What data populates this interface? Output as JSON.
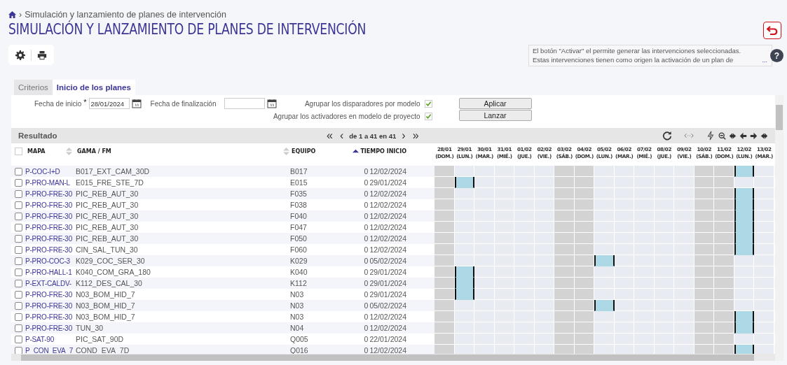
{
  "breadcrumb": {
    "separator": "›",
    "current": "Simulación y lanzamiento de planes de intervención"
  },
  "title": "SIMULACIÓN Y LANZAMIENTO DE PLANES DE INTERVENCIÓN",
  "help": {
    "text": "El botón \"Activar\" el permite generar las intervenciones seleccionadas. Estas intervenciones tienen como origen la activación de un plan de",
    "more": "...",
    "button": "?"
  },
  "tabs": [
    {
      "label": "Criterios",
      "selected": false
    },
    {
      "label": "Inicio de los planes",
      "selected": true
    }
  ],
  "form": {
    "start_label": "Fecha de inicio",
    "required_mark": "*",
    "start_value": "28/01/2024",
    "end_label": "Fecha de finalización",
    "options": [
      {
        "label": "Agrupar los disparadores por modelo",
        "checked": true
      },
      {
        "label": "Agrupar los activadores en modelo de proyecto",
        "checked": true
      }
    ],
    "buttons": [
      "Aplicar",
      "Lanzar"
    ]
  },
  "result": {
    "title": "Resultado",
    "first": "«",
    "prev": "‹",
    "range": "de 1 a 41 en 41",
    "next": "›",
    "last": "»"
  },
  "select_all": {
    "checked": false
  },
  "columns": [
    {
      "label": "MAPA",
      "kind": "plain"
    },
    {
      "label": "GAMA / FM",
      "kind": "sortable"
    },
    {
      "label": "EQUIPO",
      "kind": "sortable"
    },
    {
      "label": "TIEMPO INICIO",
      "kind": "ascending"
    }
  ],
  "days": [
    {
      "date": "28/01",
      "weekday": "(DOM.)",
      "weekend": true
    },
    {
      "date": "29/01",
      "weekday": "(LUN.)",
      "weekend": false
    },
    {
      "date": "30/01",
      "weekday": "(MAR.)",
      "weekend": false
    },
    {
      "date": "31/01",
      "weekday": "(MIÉ.)",
      "weekend": false
    },
    {
      "date": "01/02",
      "weekday": "(JUE.)",
      "weekend": false
    },
    {
      "date": "02/02",
      "weekday": "(VIE.)",
      "weekend": false
    },
    {
      "date": "03/02",
      "weekday": "(SÁB.)",
      "weekend": true
    },
    {
      "date": "04/02",
      "weekday": "(DOM.)",
      "weekend": true
    },
    {
      "date": "05/02",
      "weekday": "(LUN.)",
      "weekend": false
    },
    {
      "date": "06/02",
      "weekday": "(MAR.)",
      "weekend": false
    },
    {
      "date": "07/02",
      "weekday": "(MIÉ.)",
      "weekend": false
    },
    {
      "date": "08/02",
      "weekday": "(JUE.)",
      "weekend": false
    },
    {
      "date": "09/02",
      "weekday": "(VIE.)",
      "weekend": false
    },
    {
      "date": "10/02",
      "weekday": "(SÁB.)",
      "weekend": true
    },
    {
      "date": "11/02",
      "weekday": "(DOM.)",
      "weekend": true
    },
    {
      "date": "12/02",
      "weekday": "(LUN.)",
      "weekend": false
    },
    {
      "date": "13/02",
      "weekday": "(MAR.)",
      "weekend": false
    }
  ],
  "rows": [
    {
      "checked": false,
      "mapa": "P-COC-I+D",
      "gama": "B017_EXT_CAM_30D",
      "equipo": "B017",
      "duration": "0",
      "start": "12/02/2024",
      "planned": [
        false,
        false,
        false,
        false,
        false,
        false,
        false,
        false,
        false,
        false,
        false,
        false,
        false,
        false,
        false,
        true,
        false
      ]
    },
    {
      "checked": false,
      "mapa": "P-PRO-MAN-L",
      "gama": "E015_FRE_STE_7D",
      "equipo": "E015",
      "duration": "0",
      "start": "29/01/2024",
      "planned": [
        false,
        true,
        false,
        false,
        false,
        false,
        false,
        false,
        false,
        false,
        false,
        false,
        false,
        false,
        false,
        false,
        false
      ]
    },
    {
      "checked": false,
      "mapa": "P-PRO-FRE-30",
      "gama": "PIC_REB_AUT_30",
      "equipo": "F035",
      "duration": "0",
      "start": "12/02/2024",
      "planned": [
        false,
        false,
        false,
        false,
        false,
        false,
        false,
        false,
        false,
        false,
        false,
        false,
        false,
        false,
        false,
        true,
        false
      ]
    },
    {
      "checked": false,
      "mapa": "P-PRO-FRE-30",
      "gama": "PIC_REB_AUT_30",
      "equipo": "F038",
      "duration": "0",
      "start": "12/02/2024",
      "planned": [
        false,
        false,
        false,
        false,
        false,
        false,
        false,
        false,
        false,
        false,
        false,
        false,
        false,
        false,
        false,
        true,
        false
      ]
    },
    {
      "checked": false,
      "mapa": "P-PRO-FRE-30",
      "gama": "PIC_REB_AUT_30",
      "equipo": "F040",
      "duration": "0",
      "start": "12/02/2024",
      "planned": [
        false,
        false,
        false,
        false,
        false,
        false,
        false,
        false,
        false,
        false,
        false,
        false,
        false,
        false,
        false,
        true,
        false
      ]
    },
    {
      "checked": false,
      "mapa": "P-PRO-FRE-30",
      "gama": "PIC_REB_AUT_30",
      "equipo": "F047",
      "duration": "0",
      "start": "12/02/2024",
      "planned": [
        false,
        false,
        false,
        false,
        false,
        false,
        false,
        false,
        false,
        false,
        false,
        false,
        false,
        false,
        false,
        true,
        false
      ]
    },
    {
      "checked": false,
      "mapa": "P-PRO-FRE-30",
      "gama": "PIC_REB_AUT_30",
      "equipo": "F050",
      "duration": "0",
      "start": "12/02/2024",
      "planned": [
        false,
        false,
        false,
        false,
        false,
        false,
        false,
        false,
        false,
        false,
        false,
        false,
        false,
        false,
        false,
        true,
        false
      ]
    },
    {
      "checked": false,
      "mapa": "P-PRO-FRE-30",
      "gama": "CIN_SAL_TUN_30",
      "equipo": "F060",
      "duration": "0",
      "start": "12/02/2024",
      "planned": [
        false,
        false,
        false,
        false,
        false,
        false,
        false,
        false,
        false,
        false,
        false,
        false,
        false,
        false,
        false,
        true,
        false
      ]
    },
    {
      "checked": false,
      "mapa": "P-PRO-COC-3",
      "gama": "K029_COC_SER_30",
      "equipo": "K029",
      "duration": "0",
      "start": "05/02/2024",
      "planned": [
        false,
        false,
        false,
        false,
        false,
        false,
        false,
        false,
        true,
        false,
        false,
        false,
        false,
        false,
        false,
        false,
        false
      ]
    },
    {
      "checked": false,
      "mapa": "P-PRO-HALL-1",
      "gama": "K040_COM_GRA_180",
      "equipo": "K040",
      "duration": "0",
      "start": "29/01/2024",
      "planned": [
        false,
        true,
        false,
        false,
        false,
        false,
        false,
        false,
        false,
        false,
        false,
        false,
        false,
        false,
        false,
        false,
        false
      ]
    },
    {
      "checked": false,
      "mapa": "P-EXT-CALDV-",
      "gama": "K112_DES_CAL_30",
      "equipo": "K112",
      "duration": "0",
      "start": "29/01/2024",
      "planned": [
        false,
        true,
        false,
        false,
        false,
        false,
        false,
        false,
        false,
        false,
        false,
        false,
        false,
        false,
        false,
        false,
        false
      ]
    },
    {
      "checked": false,
      "mapa": "P-PRO-FRE-30",
      "gama": "N03_BOM_HID_7",
      "equipo": "N03",
      "duration": "0",
      "start": "29/01/2024",
      "planned": [
        false,
        true,
        false,
        false,
        false,
        false,
        false,
        false,
        false,
        false,
        false,
        false,
        false,
        false,
        false,
        false,
        false
      ]
    },
    {
      "checked": false,
      "mapa": "P-PRO-FRE-30",
      "gama": "N03_BOM_HID_7",
      "equipo": "N03",
      "duration": "0",
      "start": "05/02/2024",
      "planned": [
        false,
        false,
        false,
        false,
        false,
        false,
        false,
        false,
        true,
        false,
        false,
        false,
        false,
        false,
        false,
        false,
        false
      ]
    },
    {
      "checked": false,
      "mapa": "P-PRO-FRE-30",
      "gama": "N03_BOM_HID_7",
      "equipo": "N03",
      "duration": "0",
      "start": "12/02/2024",
      "planned": [
        false,
        false,
        false,
        false,
        false,
        false,
        false,
        false,
        false,
        false,
        false,
        false,
        false,
        false,
        false,
        true,
        false
      ]
    },
    {
      "checked": false,
      "mapa": "P-PRO-FRE-30",
      "gama": "TUN_30",
      "equipo": "N04",
      "duration": "0",
      "start": "12/02/2024",
      "planned": [
        false,
        false,
        false,
        false,
        false,
        false,
        false,
        false,
        false,
        false,
        false,
        false,
        false,
        false,
        false,
        true,
        false
      ]
    },
    {
      "checked": false,
      "mapa": "P-SAT-90",
      "gama": "PIC_SAT_90D",
      "equipo": "Q005",
      "duration": "0",
      "start": "22/01/2024",
      "planned": [
        false,
        false,
        false,
        false,
        false,
        false,
        false,
        false,
        false,
        false,
        false,
        false,
        false,
        false,
        false,
        false,
        false
      ]
    },
    {
      "checked": false,
      "mapa": "P_CON_EVA_7",
      "gama": "COND_EVA_7D",
      "equipo": "Q016",
      "duration": "0",
      "start": "12/02/2024",
      "planned": [
        false,
        false,
        false,
        false,
        false,
        false,
        false,
        false,
        false,
        false,
        false,
        false,
        false,
        false,
        false,
        true,
        false
      ]
    }
  ]
}
